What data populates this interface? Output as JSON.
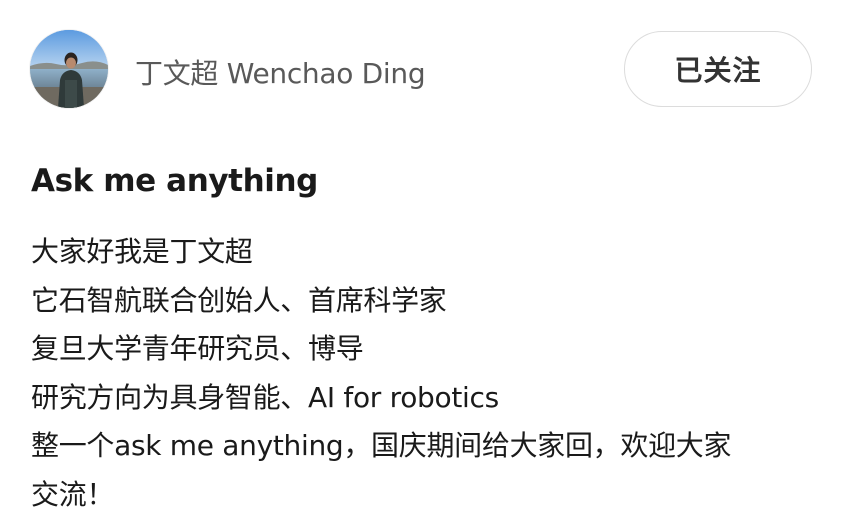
{
  "author": {
    "name": "丁文超 Wenchao Ding",
    "avatar_icon": "person-lakeside-avatar"
  },
  "follow_button": {
    "label": "已关注"
  },
  "post": {
    "title": "Ask me anything",
    "lines": [
      "大家好我是丁文超",
      "它石智航联合创始人、首席科学家",
      "复旦大学青年研究员、博导",
      "研究方向为具身智能、AI for robotics",
      "整一个ask me anything，国庆期间给大家回，欢迎大家",
      "交流！"
    ]
  },
  "colors": {
    "name_text": "#595959",
    "button_border": "#dcdcdc",
    "text": "#1a1a1a"
  }
}
